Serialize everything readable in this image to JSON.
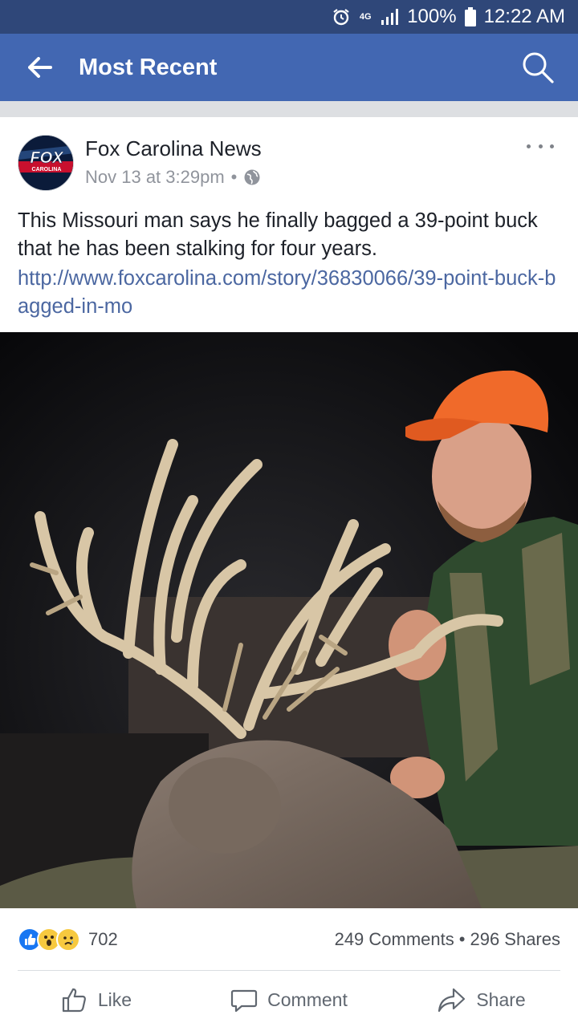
{
  "status_bar": {
    "network": "4G",
    "battery": "100%",
    "time": "12:22 AM"
  },
  "app_bar": {
    "title": "Most Recent"
  },
  "post": {
    "author": "Fox Carolina News",
    "timestamp": "Nov 13 at 3:29pm",
    "separator": "•",
    "text": "This Missouri man says he finally bagged a 39-point buck that he has been stalking for four years.",
    "link": "http://www.foxcarolina.com/story/36830066/39-point-buck-bagged-in-mo",
    "avatar_logo": "FOX",
    "avatar_sub": "CAROLINA",
    "reactions_count": "702",
    "comments": "249 Comments",
    "shares": "296 Shares"
  },
  "actions": {
    "like": "Like",
    "comment": "Comment",
    "share": "Share"
  },
  "colors": {
    "status_bar": "#2f4779",
    "app_bar": "#4267b2",
    "link": "#4b67a1"
  }
}
